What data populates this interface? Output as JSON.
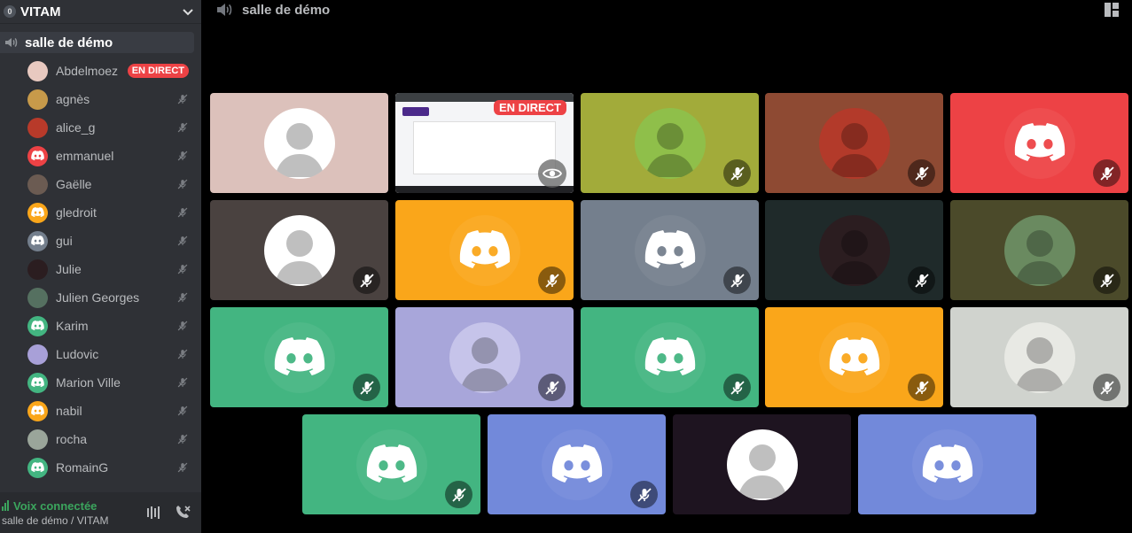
{
  "server": {
    "badge": "0",
    "name": "VITAM"
  },
  "channel": {
    "name": "salle de démo"
  },
  "members": [
    {
      "name": "Abdelmoez",
      "live": "EN DIRECT",
      "avatar_color": "#e8c9c0"
    },
    {
      "name": "agnès",
      "avatar_color": "#c79a4a"
    },
    {
      "name": "alice_g",
      "avatar_color": "#b83a2a"
    },
    {
      "name": "emmanuel",
      "avatar_color": "#ed4245"
    },
    {
      "name": "Gaëlle",
      "avatar_color": "#6b5b52"
    },
    {
      "name": "gledroit",
      "avatar_color": "#faa61a"
    },
    {
      "name": "gui",
      "avatar_color": "#747f8d"
    },
    {
      "name": "Julie",
      "avatar_color": "#2b1d20"
    },
    {
      "name": "Julien Georges",
      "avatar_color": "#557060"
    },
    {
      "name": "Karim",
      "avatar_color": "#43b581"
    },
    {
      "name": "Ludovic",
      "avatar_color": "#a8a0d8"
    },
    {
      "name": "Marion Ville",
      "avatar_color": "#43b581"
    },
    {
      "name": "nabil",
      "avatar_color": "#faa61a"
    },
    {
      "name": "rocha",
      "avatar_color": "#9aa59a"
    },
    {
      "name": "RomainG",
      "avatar_color": "#43b581"
    }
  ],
  "voice_panel": {
    "status": "Voix connectée",
    "location": "salle de démo / VITAM"
  },
  "main": {
    "title": "salle de démo"
  },
  "stream": {
    "live_label": "EN DIRECT"
  },
  "tiles": [
    {
      "bg": "#dcc1bb",
      "kind": "photo",
      "circle": "#ffffff",
      "muted": false
    },
    {
      "bg": "#f4f5f7",
      "kind": "screen",
      "muted": false
    },
    {
      "bg": "#a2ab3a",
      "kind": "photo",
      "circle": "#8fbf4a",
      "muted": true
    },
    {
      "bg": "#8e4a33",
      "kind": "photo",
      "circle": "#b33a2a",
      "muted": true
    },
    {
      "bg": "#ed4245",
      "kind": "discord",
      "muted": true
    },
    {
      "bg": "#4a4240",
      "kind": "photo",
      "circle": "#ffffff",
      "muted": true
    },
    {
      "bg": "#faa61a",
      "kind": "discord",
      "muted": true
    },
    {
      "bg": "#747f8d",
      "kind": "discord",
      "muted": true
    },
    {
      "bg": "#1f2a2a",
      "kind": "photo",
      "circle": "#2b1d20",
      "muted": true
    },
    {
      "bg": "#4b4a2a",
      "kind": "photo",
      "circle": "#6a8a60",
      "muted": true
    },
    {
      "bg": "#43b581",
      "kind": "discord",
      "muted": true
    },
    {
      "bg": "#a8a6da",
      "kind": "photo",
      "circle": "#c6c4ea",
      "muted": true
    },
    {
      "bg": "#43b581",
      "kind": "discord",
      "muted": true
    },
    {
      "bg": "#faa61a",
      "kind": "discord",
      "muted": true
    },
    {
      "bg": "#d0d3ce",
      "kind": "photo",
      "circle": "#e8e9e4",
      "muted": true
    },
    {
      "bg": "#43b581",
      "kind": "discord",
      "muted": true
    },
    {
      "bg": "#7289da",
      "kind": "discord",
      "muted": true
    },
    {
      "bg": "#1e1420",
      "kind": "photo",
      "circle": "#ffffff",
      "muted": false
    },
    {
      "bg": "#7289da",
      "kind": "discord",
      "muted": false
    }
  ]
}
